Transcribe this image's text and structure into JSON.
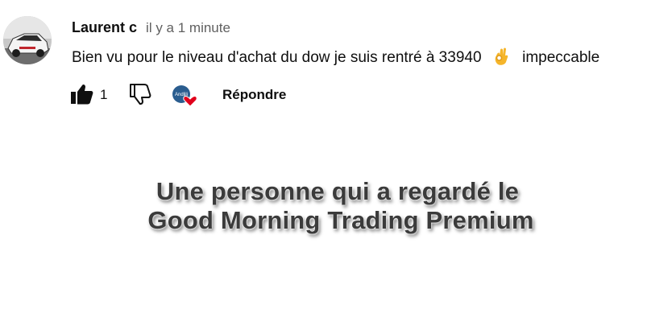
{
  "comment": {
    "author": "Laurent c",
    "time": "il y a 1 minute",
    "text_before": "Bien vu pour le niveau d'achat du dow je suis rentré à 33940",
    "emoji": "ok-hand-emoji",
    "text_after": "impeccable",
    "like_count": "1",
    "reply_label": "Répondre",
    "creator_badge_text": "Andlili"
  },
  "caption": {
    "line1": "Une personne qui a regardé le",
    "line2": "Good Morning Trading Premium"
  },
  "colors": {
    "author": "#0f0f0f",
    "time": "#606060",
    "heart": "#e0001b",
    "caption_text": "#3b3b3b"
  }
}
